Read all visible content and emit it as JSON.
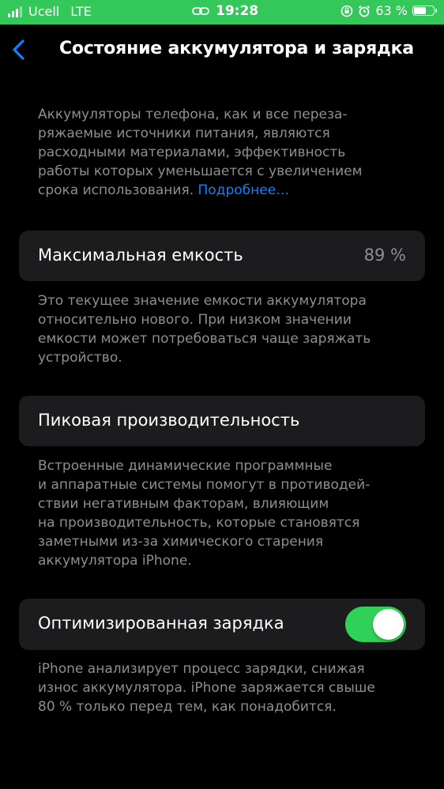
{
  "status_bar": {
    "carrier": "Ucell",
    "network": "LTE",
    "time": "19:28",
    "battery_percent_label": "63 %",
    "battery_level": 0.63,
    "icons": [
      "signal-icon",
      "link-icon",
      "orientation-lock-icon",
      "alarm-icon",
      "battery-icon"
    ],
    "background_color": "#34c759"
  },
  "nav": {
    "back_icon": "chevron-left-icon",
    "title": "Состояние аккумулятора и зарядка"
  },
  "intro": {
    "text": "Аккумуляторы телефона, как и все переза-\nряжаемые источники питания, являются\nрасходными материалами, эффективность\nработы которых уменьшается с увеличением\nсрока использования. ",
    "link": "Подробнее…"
  },
  "max_capacity": {
    "label": "Максимальная емкость",
    "value": "89 %",
    "footnote": "Это текущее значение емкости аккумулятора\nотносительно нового. При низком значении\nемкости может потребоваться чаще заряжать\nустройство."
  },
  "peak_performance": {
    "label": "Пиковая производительность",
    "footnote": "Встроенные динамические программные\nи аппаратные системы помогут в противодей-\nствии негативным факторам, влияющим\nна производительность, которые становятся\nзаметными из-за химического старения\nаккумулятора iPhone."
  },
  "optimized_charging": {
    "label": "Оптимизированная зарядка",
    "enabled": true,
    "footnote": "iPhone анализирует процесс зарядки, снижая\nизнос аккумулятора. iPhone заряжается свыше\n80 % только перед тем, как понадобится."
  },
  "colors": {
    "accent": "#0a84ff",
    "toggle_on": "#30d158",
    "cell_background": "#1c1c1e",
    "secondary_text": "#8e8e93"
  }
}
